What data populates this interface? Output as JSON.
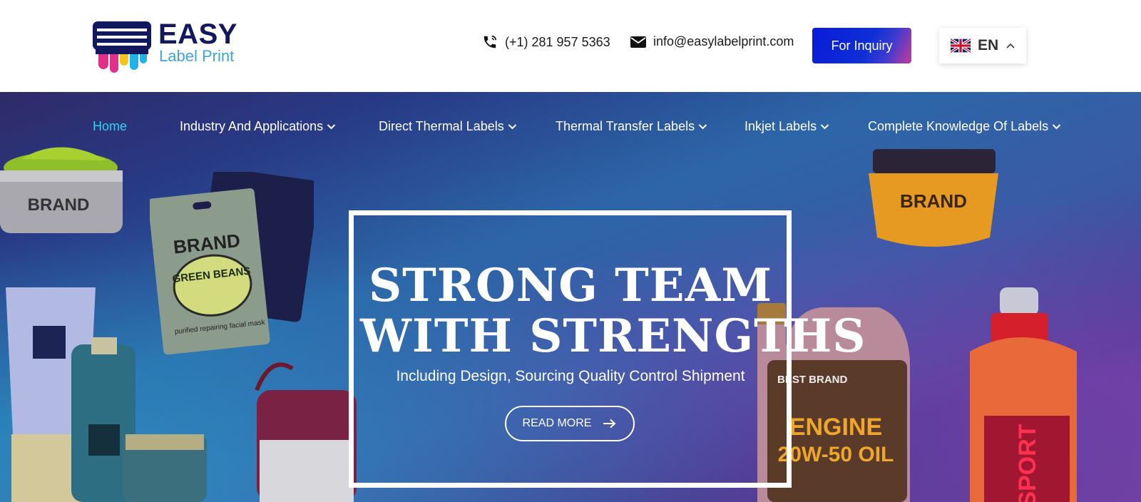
{
  "brand": {
    "name_line1": "EASY",
    "name_line2": "Label Print",
    "colors": {
      "navy": "#12185e",
      "sky": "#3fa7d8",
      "magenta": "#e0308a",
      "yellow": "#f4c51c",
      "cyan": "#1fb3e6"
    }
  },
  "header": {
    "phone": "(+1) 281 957 5363",
    "email": "info@easylabelprint.com",
    "inquiry_label": "For Inquiry",
    "language": {
      "code": "EN",
      "flag": "uk-flag-icon"
    }
  },
  "nav": {
    "items": [
      {
        "label": "Home",
        "active": true,
        "has_dropdown": false
      },
      {
        "label": "Industry And Applications",
        "active": false,
        "has_dropdown": true
      },
      {
        "label": "Direct Thermal Labels",
        "active": false,
        "has_dropdown": true
      },
      {
        "label": "Thermal Transfer Labels",
        "active": false,
        "has_dropdown": true
      },
      {
        "label": "Inkjet Labels",
        "active": false,
        "has_dropdown": true
      },
      {
        "label": "Complete Knowledge Of Labels",
        "active": false,
        "has_dropdown": true
      }
    ],
    "active_color": "#33d0f2"
  },
  "hero": {
    "title_line1": "STRONG TEAM",
    "title_line2": "WITH STRENGTHS",
    "subtitle": "Including Design, Sourcing Quality Control Shipment",
    "cta_label": "READ MORE",
    "products": {
      "left_jar_brand": "BRAND",
      "pouch_brand": "BRAND",
      "pouch_title": "GREEN BEANS",
      "pouch_caption": "purified repairing facial mask",
      "right_jar_brand": "BRAND",
      "oil_brand": "BEST BRAND",
      "oil_title": "ENGINE",
      "oil_grade": "20W-50 OIL",
      "drink_label": "SPORT"
    }
  }
}
